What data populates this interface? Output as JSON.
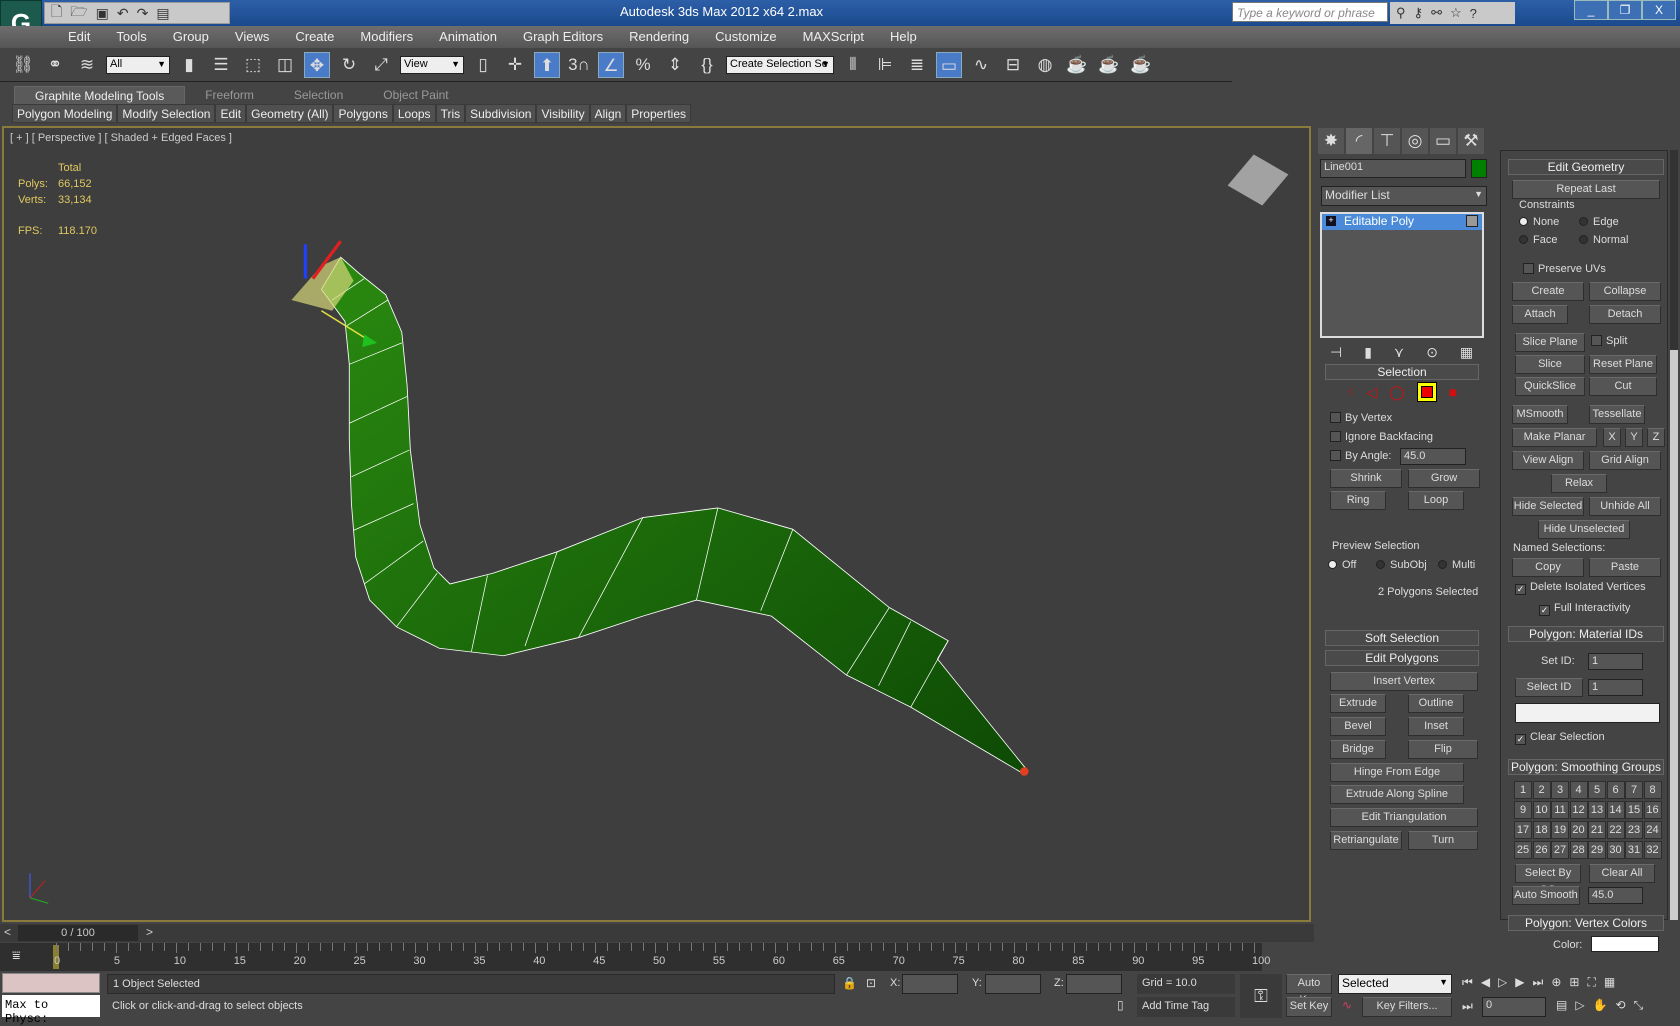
{
  "title": "Autodesk 3ds Max  2012 x64      2.max",
  "search_placeholder": "Type a keyword or phrase",
  "menu": [
    "Edit",
    "Tools",
    "Group",
    "Views",
    "Create",
    "Modifiers",
    "Animation",
    "Graph Editors",
    "Rendering",
    "Customize",
    "MAXScript",
    "Help"
  ],
  "toolbar": {
    "filter": "All",
    "ref_coord": "View",
    "named_sel": "Create Selection Se"
  },
  "ribbon_tabs": [
    "Graphite Modeling Tools",
    "Freeform",
    "Selection",
    "Object Paint"
  ],
  "ribbon_sub": [
    "Polygon Modeling",
    "Modify Selection",
    "Edit",
    "Geometry (All)",
    "Polygons",
    "Loops",
    "Tris",
    "Subdivision",
    "Visibility",
    "Align",
    "Properties"
  ],
  "viewport": {
    "label": "[ + ] [ Perspective ] [ Shaded + Edged Faces ]",
    "total": "Total",
    "polys_label": "Polys:",
    "polys": "66,152",
    "verts_label": "Verts:",
    "verts": "33,134",
    "fps_label": "FPS:",
    "fps": "118.170",
    "mesh_color": "#1f6e0a"
  },
  "command": {
    "object_name": "Line001",
    "object_color": "#008000",
    "modifier_list": "Modifier List",
    "stack_item": "Editable Poly",
    "selection": {
      "title": "Selection",
      "by_vertex": "By Vertex",
      "ignore_backfacing": "Ignore Backfacing",
      "by_angle": "By Angle:",
      "angle": "45.0",
      "shrink": "Shrink",
      "grow": "Grow",
      "ring": "Ring",
      "loop": "Loop",
      "preview": "Preview Selection",
      "off": "Off",
      "subobj": "SubObj",
      "multi": "Multi",
      "status": "2 Polygons Selected"
    },
    "soft_selection": "Soft Selection",
    "edit_polygons": {
      "title": "Edit Polygons",
      "insert_vertex": "Insert Vertex",
      "extrude": "Extrude",
      "outline": "Outline",
      "bevel": "Bevel",
      "inset": "Inset",
      "bridge": "Bridge",
      "flip": "Flip",
      "hinge": "Hinge From Edge",
      "extrude_spline": "Extrude Along Spline",
      "edit_tri": "Edit Triangulation",
      "retri": "Retriangulate",
      "turn": "Turn"
    }
  },
  "edit_geometry": {
    "title": "Edit Geometry",
    "repeat_last": "Repeat Last",
    "constraints": "Constraints",
    "none": "None",
    "edge": "Edge",
    "face": "Face",
    "normal": "Normal",
    "preserve_uvs": "Preserve UVs",
    "create": "Create",
    "collapse": "Collapse",
    "attach": "Attach",
    "detach": "Detach",
    "slice_plane": "Slice Plane",
    "split": "Split",
    "slice": "Slice",
    "reset_plane": "Reset Plane",
    "quickslice": "QuickSlice",
    "cut": "Cut",
    "msmooth": "MSmooth",
    "tessellate": "Tessellate",
    "make_planar": "Make Planar",
    "x": "X",
    "y": "Y",
    "z": "Z",
    "view_align": "View Align",
    "grid_align": "Grid Align",
    "relax": "Relax",
    "hide_selected": "Hide Selected",
    "unhide_all": "Unhide All",
    "hide_unselected": "Hide Unselected",
    "named_sel": "Named Selections:",
    "copy": "Copy",
    "paste": "Paste",
    "delete_isolated": "Delete Isolated Vertices",
    "full_interactivity": "Full Interactivity"
  },
  "material_ids": {
    "title": "Polygon: Material IDs",
    "set_id": "Set ID:",
    "set_id_val": "1",
    "select_id": "Select ID",
    "select_id_val": "1",
    "clear_selection": "Clear Selection"
  },
  "smoothing": {
    "title": "Polygon: Smoothing Groups",
    "select_by_sg": "Select By SG",
    "clear_all": "Clear All",
    "auto_smooth": "Auto Smooth",
    "auto_val": "45.0"
  },
  "vertex_colors": {
    "title": "Polygon: Vertex Colors",
    "color": "Color:"
  },
  "timeline": {
    "frame": "0 / 100",
    "ticks": [
      "0",
      "5",
      "10",
      "15",
      "20",
      "25",
      "30",
      "35",
      "40",
      "45",
      "50",
      "55",
      "60",
      "65",
      "70",
      "75",
      "80",
      "85",
      "90",
      "95",
      "100"
    ]
  },
  "status": {
    "listener": "Max to Physc:",
    "selected": "1 Object Selected",
    "prompt": "Click or click-and-drag to select objects",
    "x": "X:",
    "y": "Y:",
    "z": "Z:",
    "grid": "Grid = 10.0",
    "add_time_tag": "Add Time Tag",
    "auto_key": "Auto Key",
    "set_key": "Set Key",
    "key_mode": "Selected",
    "key_filters": "Key Filters...",
    "current_frame": "0"
  }
}
